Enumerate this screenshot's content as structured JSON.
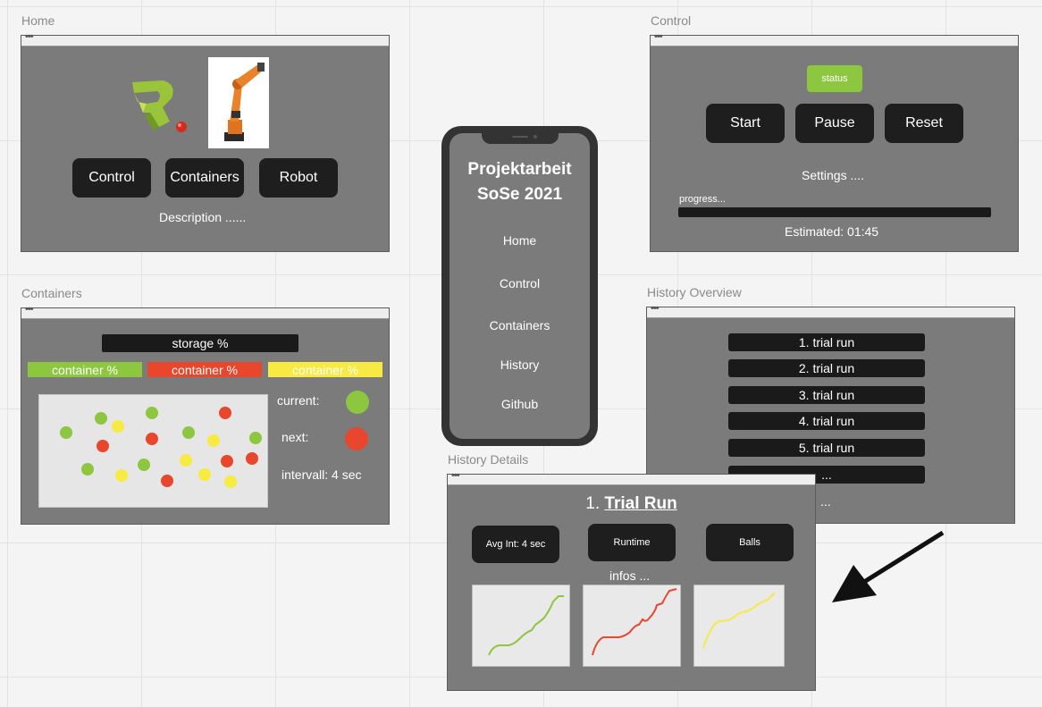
{
  "colors": {
    "green": "#8dc63f",
    "red": "#e8472d",
    "yellow": "#f7ea43",
    "dark": "#1e1e1e",
    "window": "#7b7b7b"
  },
  "home": {
    "frame_title": "Home",
    "buttons": [
      "Control",
      "Containers",
      "Robot"
    ],
    "description": "Description ......"
  },
  "control": {
    "frame_title": "Control",
    "status": "status",
    "buttons": [
      "Start",
      "Pause",
      "Reset"
    ],
    "settings": "Settings ....",
    "progress_label": "progress...",
    "estimated": "Estimated: 01:45"
  },
  "containers": {
    "frame_title": "Containers",
    "storage": "storage %",
    "bars": [
      "container %",
      "container %",
      "container %"
    ],
    "current": "current:",
    "next": "next:",
    "interval": "intervall: 4 sec"
  },
  "phone": {
    "title_line1": "Projektarbeit",
    "title_line2": "SoSe 2021",
    "menu": [
      "Home",
      "Control",
      "Containers",
      "History",
      "Github"
    ]
  },
  "history_overview": {
    "frame_title": "History Overview",
    "runs": [
      "1. trial run",
      "2. trial run",
      "3. trial run",
      "4. trial run",
      "5. trial run",
      "..."
    ],
    "more": "..."
  },
  "history_details": {
    "frame_title": "History Details",
    "run_number": "1.",
    "run_title": "Trial Run",
    "buttons": [
      "Avg Int: 4 sec",
      "Runtime",
      "Balls"
    ],
    "infos": "infos ..."
  },
  "window_dots": "•••"
}
